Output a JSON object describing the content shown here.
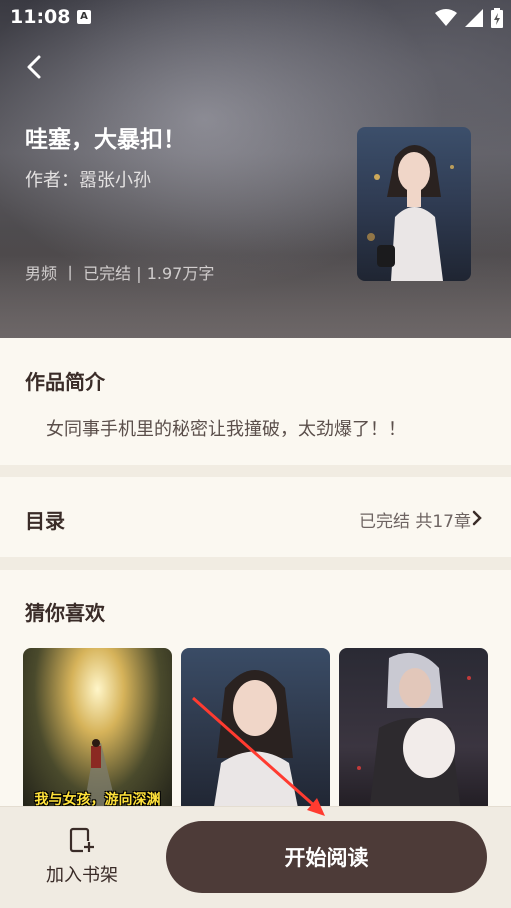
{
  "status_bar": {
    "time": "11:08",
    "badge": "A"
  },
  "header": {
    "title": "哇塞，大暴扣！",
    "author": "作者：嚣张小孙",
    "meta": "男频  丨  已完结 | 1.97万字"
  },
  "intro": {
    "heading": "作品简介",
    "text": "女同事手机里的秘密让我撞破，太劲爆了！！"
  },
  "toc": {
    "heading": "目录",
    "status": "已完结 共17章"
  },
  "recommend": {
    "heading": "猜你喜欢",
    "items": [
      {
        "caption": "我与女孩，游向深渊"
      },
      {
        "caption": ""
      },
      {
        "caption": ""
      }
    ]
  },
  "bottom": {
    "shelf_label": "加入书架",
    "read_label": "开始阅读"
  },
  "colors": {
    "accent": "#4d3b38",
    "background": "#fbf8f1",
    "annotation": "#ff3b30"
  }
}
